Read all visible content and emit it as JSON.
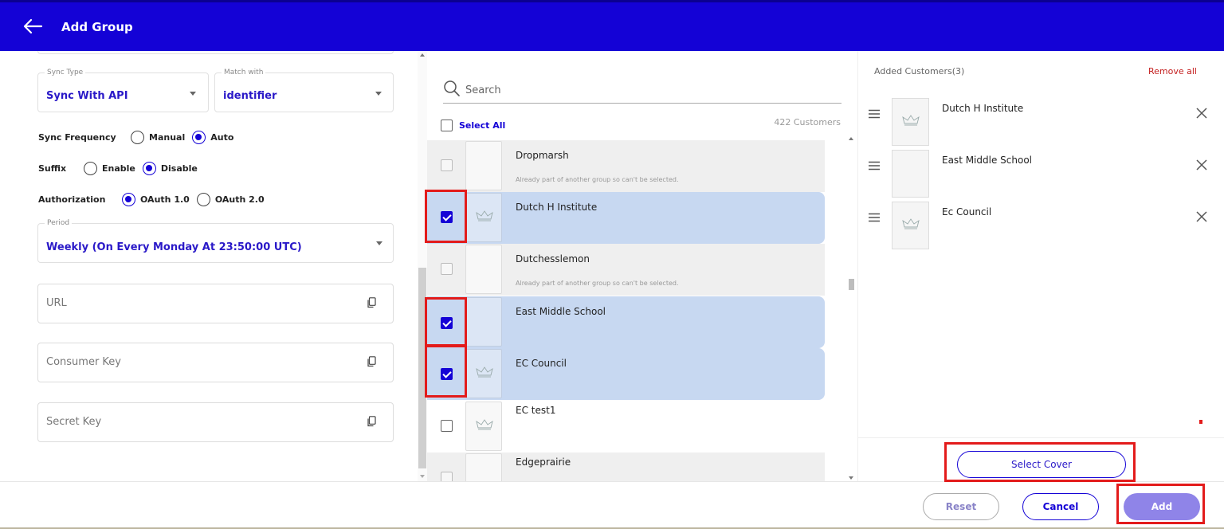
{
  "header": {
    "title": "Add Group",
    "bg": "#1402d6"
  },
  "left": {
    "sync_type": {
      "label": "Sync Type",
      "value": "Sync With API"
    },
    "match_with": {
      "label": "Match with",
      "value": "identifier"
    },
    "sync_frequency": {
      "label": "Sync Frequency",
      "options": [
        "Manual",
        "Auto"
      ],
      "selected": "Auto"
    },
    "suffix": {
      "label": "Suffix",
      "options": [
        "Enable",
        "Disable"
      ],
      "selected": "Disable"
    },
    "authorization": {
      "label": "Authorization",
      "options": [
        "OAuth 1.0",
        "OAuth 2.0"
      ],
      "selected": "OAuth 1.0"
    },
    "period": {
      "label": "Period",
      "value": "Weekly (On Every Monday At 23:50:00 UTC)"
    },
    "url": {
      "placeholder": "URL"
    },
    "consumer_key": {
      "placeholder": "Consumer Key"
    },
    "secret_key": {
      "placeholder": "Secret Key"
    }
  },
  "middle": {
    "search": {
      "placeholder": "Search"
    },
    "select_all": "Select All",
    "count": "422 Customers",
    "customers": [
      {
        "name": "Dropmarsh",
        "note": "Already part of another group so can't be selected.",
        "state": "disabled",
        "logo": false
      },
      {
        "name": "Dutch H Institute",
        "note": "",
        "state": "selected",
        "logo": true
      },
      {
        "name": "Dutchesslemon",
        "note": "Already part of another group so can't be selected.",
        "state": "disabled",
        "logo": false
      },
      {
        "name": "East Middle School",
        "note": "",
        "state": "selected",
        "logo": false
      },
      {
        "name": "EC Council",
        "note": "",
        "state": "selected",
        "logo": true
      },
      {
        "name": "EC test1",
        "note": "",
        "state": "normal",
        "logo": true
      },
      {
        "name": "Edgeprairie",
        "note": "",
        "state": "disabled",
        "logo": false
      }
    ]
  },
  "right": {
    "title": "Added Customers(3)",
    "remove_all": "Remove all",
    "items": [
      {
        "name": "Dutch H Institute",
        "logo": true
      },
      {
        "name": "East Middle School",
        "logo": false
      },
      {
        "name": "Ec Council",
        "logo": true
      }
    ],
    "select_cover": "Select Cover"
  },
  "footer": {
    "reset": "Reset",
    "cancel": "Cancel",
    "add": "Add"
  },
  "colors": {
    "accent": "#1402d6",
    "selected_row": "#c7d8f1",
    "remove": "#c42020",
    "annotation": "#e31b1b"
  }
}
